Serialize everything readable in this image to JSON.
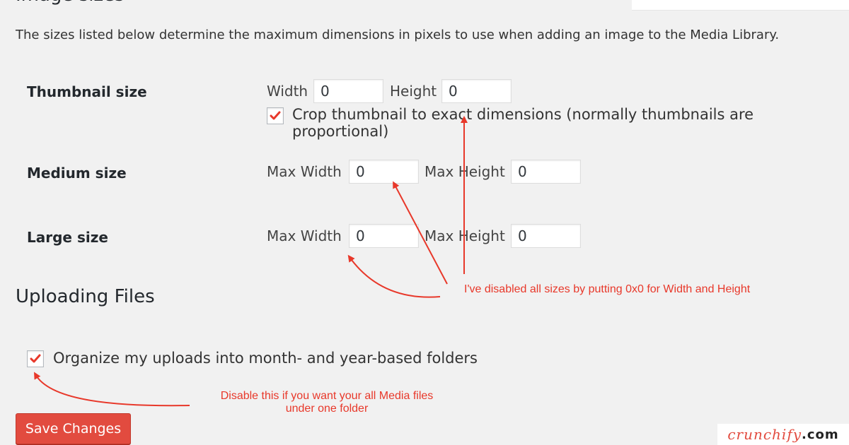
{
  "sections": {
    "image_sizes_title": "Image sizes",
    "uploading_title": "Uploading Files"
  },
  "intro_text": "The sizes listed below determine the maximum dimensions in pixels to use when adding an image to the Media Library.",
  "thumbnail": {
    "label": "Thumbnail size",
    "width_label": "Width",
    "width_value": "0",
    "height_label": "Height",
    "height_value": "0",
    "crop_checked": true,
    "crop_label": "Crop thumbnail to exact dimensions (normally thumbnails are proportional)"
  },
  "medium": {
    "label": "Medium size",
    "max_width_label": "Max Width",
    "max_width_value": "0",
    "max_height_label": "Max Height",
    "max_height_value": "0"
  },
  "large": {
    "label": "Large size",
    "max_width_label": "Max Width",
    "max_width_value": "0",
    "max_height_label": "Max Height",
    "max_height_value": "0"
  },
  "uploads": {
    "organize_checked": true,
    "organize_label": "Organize my uploads into month- and year-based folders"
  },
  "annotations": {
    "sizes_note": "I've disabled all sizes by putting 0x0 for Width and Height",
    "folder_note_line1": "Disable this if you want your all Media files",
    "folder_note_line2": "under one folder"
  },
  "save_button": "Save Changes",
  "brand": {
    "name": "crunchify",
    "tld": ".com"
  },
  "colors": {
    "annotation_red": "#e8382a",
    "button_red": "#e24b3f",
    "background": "#f1f1f1"
  }
}
